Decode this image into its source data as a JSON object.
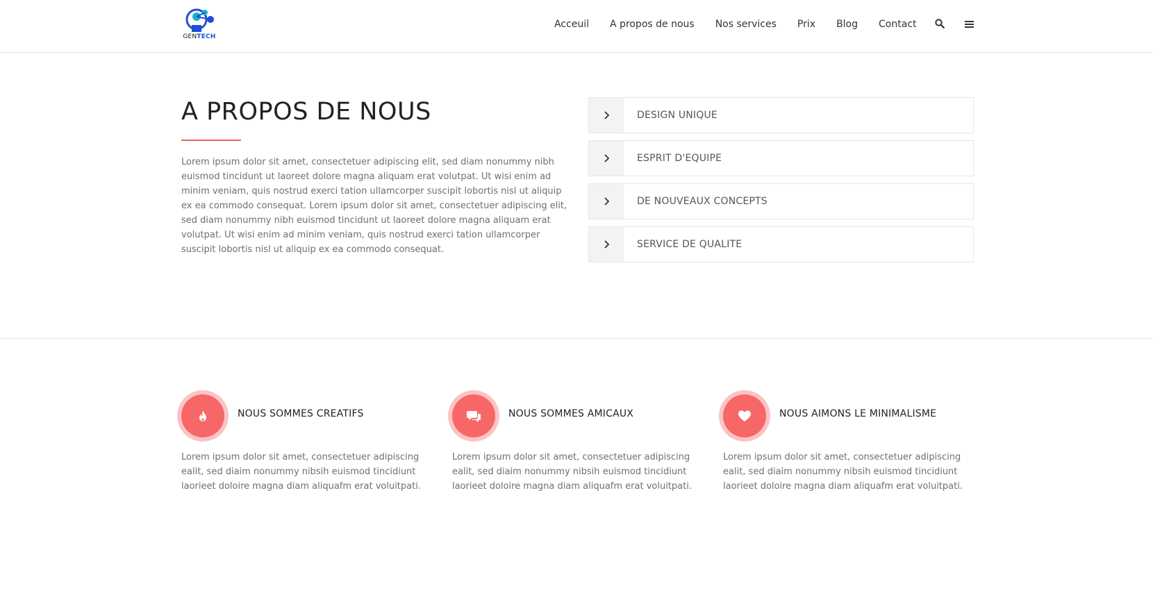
{
  "header": {
    "logo_text_1": "GEN",
    "logo_text_2": "TECH",
    "nav": [
      "Acceuil",
      "A propos de nous",
      "Nos services",
      "Prix",
      "Blog",
      "Contact"
    ],
    "icons": [
      "search-icon",
      "menu-icon"
    ]
  },
  "about": {
    "title": "A PROPOS DE NOUS",
    "text": "Lorem ipsum dolor sit amet, consectetuer adipiscing elit, sed diam nonummy nibh euismod tincidunt ut laoreet dolore magna aliquam erat volutpat. Ut wisi enim ad minim veniam, quis nostrud exerci tation ullamcorper suscipit lobortis nisl ut aliquip ex ea commodo consequat. Lorem ipsum dolor sit amet, consectetuer adipiscing elit, sed diam nonummy nibh euismod tincidunt ut laoreet dolore magna aliquam erat volutpat. Ut wisi enim ad minim veniam, quis nostrud exerci tation ullamcorper suscipit lobortis nisl ut aliquip ex ea commodo consequat.",
    "accordion": [
      "DESIGN UNIQUE",
      "ESPRIT D'EQUIPE",
      "DE NOUVEAUX CONCEPTS",
      "SERVICE DE QUALITE"
    ]
  },
  "features": [
    {
      "icon": "flame-icon",
      "title": "NOUS SOMMES CREATIFS",
      "text": "Lorem ipsum dolor sit amet, consectetuer adipiscing ealit, sed diaim nonummy nibsih euismod tincidiunt laorieet doloire magna diam aliquafm erat voluitpati."
    },
    {
      "icon": "chat-bubbles-icon",
      "title": "NOUS SOMMES AMICAUX",
      "text": "Lorem ipsum dolor sit amet, consectetuer adipiscing ealit, sed diaim nonummy nibsih euismod tincidiunt laorieet doloire magna diam aliquafm erat voluitpati."
    },
    {
      "icon": "heart-icon",
      "title": "NOUS AIMONS LE MINIMALISME",
      "text": "Lorem ipsum dolor sit amet, consectetuer adipiscing ealit, sed diaim nonummy nibsih euismod tincidiunt laorieet doloire magna diam aliquafm erat voluitpati."
    }
  ],
  "colors": {
    "accent": "#f76767",
    "accent_ring": "#fbc4c4",
    "text_muted": "#6f6f6f",
    "border": "#e6e6e6"
  }
}
